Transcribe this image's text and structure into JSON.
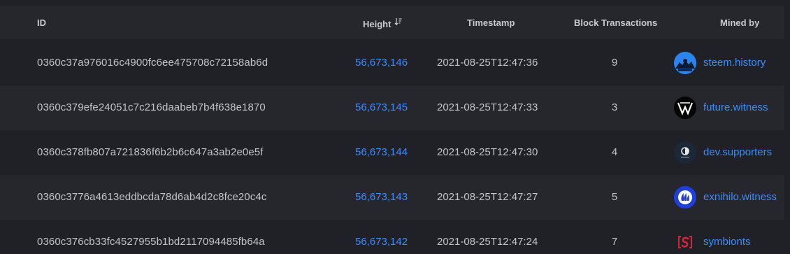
{
  "columns": {
    "id": "ID",
    "height": "Height",
    "timestamp": "Timestamp",
    "block_transactions": "Block Transactions",
    "mined_by": "Mined by"
  },
  "sort_icon": "sort-descending-icon",
  "colors": {
    "background": "#202126",
    "row_alt": "#26272d",
    "link": "#3b8cff",
    "text": "#c3c3c8"
  },
  "rows": [
    {
      "id": "0360c37a976016c4900fc6ee475708c72158ab6d",
      "height": "56,673,146",
      "timestamp": "2021-08-25T12:47:36",
      "transactions": "9",
      "miner": "steem.history",
      "avatar_icon": "steem-history-avatar-icon"
    },
    {
      "id": "0360c379efe24051c7c216daabeb7b4f638e1870",
      "height": "56,673,145",
      "timestamp": "2021-08-25T12:47:33",
      "transactions": "3",
      "miner": "future.witness",
      "avatar_icon": "future-witness-avatar-icon"
    },
    {
      "id": "0360c378fb807a721836f6b2b6c647a3ab2e0e5f",
      "height": "56,673,144",
      "timestamp": "2021-08-25T12:47:30",
      "transactions": "4",
      "miner": "dev.supporters",
      "avatar_icon": "dev-supporters-avatar-icon"
    },
    {
      "id": "0360c3776a4613eddbcda78d6ab4d2c8fce20c4c",
      "height": "56,673,143",
      "timestamp": "2021-08-25T12:47:27",
      "transactions": "5",
      "miner": "exnihilo.witness",
      "avatar_icon": "exnihilo-witness-avatar-icon"
    },
    {
      "id": "0360c376cb33fc4527955b1bd2117094485fb64a",
      "height": "56,673,142",
      "timestamp": "2021-08-25T12:47:24",
      "transactions": "7",
      "miner": "symbionts",
      "avatar_icon": "symbionts-avatar-icon"
    }
  ]
}
